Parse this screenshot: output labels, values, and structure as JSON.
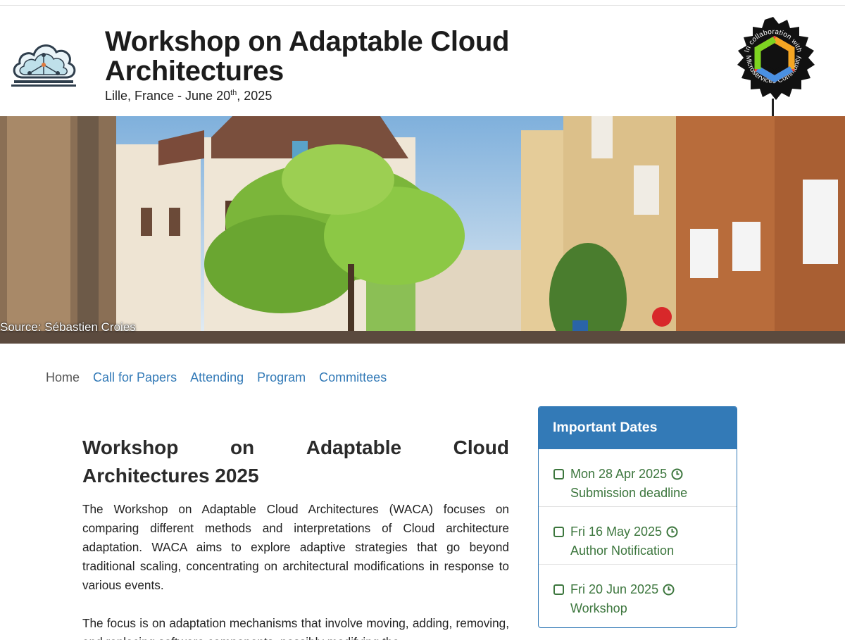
{
  "header": {
    "title": "Workshop on Adaptable Cloud Architectures",
    "subtitle_prefix": "Lille, France - June 20",
    "subtitle_sup": "th",
    "subtitle_suffix": ", 2025",
    "badge_ring_text": "In collaboration with Microservices Community"
  },
  "hero": {
    "caption": "Source: Sébastien Croies"
  },
  "nav": {
    "items": [
      {
        "label": "Home",
        "active": true
      },
      {
        "label": "Call for Papers",
        "active": false
      },
      {
        "label": "Attending",
        "active": false
      },
      {
        "label": "Program",
        "active": false
      },
      {
        "label": "Committees",
        "active": false
      }
    ]
  },
  "main": {
    "heading_line1": [
      "Workshop",
      "on",
      "Adaptable",
      "Cloud"
    ],
    "heading_line2": "Architectures 2025",
    "paragraph1": "The Workshop on Adaptable Cloud Architectures (WACA) focuses on comparing different methods and interpretations of Cloud architecture adaptation. WACA aims to explore adaptive strategies that go beyond traditional scaling, concentrating on architectural modifications in response to various events.",
    "paragraph2": "The focus is on adaptation mechanisms that involve moving, adding, removing, and replacing software components, possibly modifying the"
  },
  "important_dates": {
    "title": "Important Dates",
    "items": [
      {
        "date": "Mon 28 Apr 2025",
        "label": "Submission deadline"
      },
      {
        "date": "Fri 16 May 2025",
        "label": "Author Notification"
      },
      {
        "date": "Fri 20 Jun 2025",
        "label": "Workshop"
      }
    ]
  },
  "colors": {
    "link": "#337ab7",
    "panel_heading": "#337ab7",
    "dates_text": "#3c763d",
    "nav_active": "#555555"
  }
}
